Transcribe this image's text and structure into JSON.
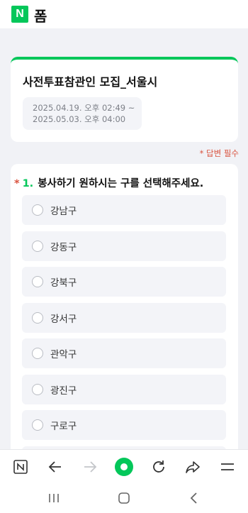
{
  "header": {
    "logo_text": "N",
    "title": "폼"
  },
  "form": {
    "title": "사전투표참관인 모집_서울시",
    "period_start": "2025.04.19. 오후 02:49 ~",
    "period_end": "2025.05.03. 오후 04:00"
  },
  "required_note": "* 답변 필수",
  "question": {
    "star": "*",
    "number": "1.",
    "text": "봉사하기 원하시는 구를 선택해주세요.",
    "options": [
      "강남구",
      "강동구",
      "강북구",
      "강서구",
      "관악구",
      "광진구",
      "구로구"
    ]
  },
  "toolbar": {
    "icons": [
      "naver-home-icon",
      "back-arrow-icon",
      "forward-arrow-icon",
      "green-dot-icon",
      "refresh-icon",
      "share-icon",
      "menu-icon"
    ]
  },
  "system_nav": {
    "icons": [
      "recent-apps-icon",
      "home-icon",
      "back-icon"
    ]
  },
  "colors": {
    "accent": "#03c75a",
    "required": "#d9533f",
    "background": "#f1f2f6"
  }
}
